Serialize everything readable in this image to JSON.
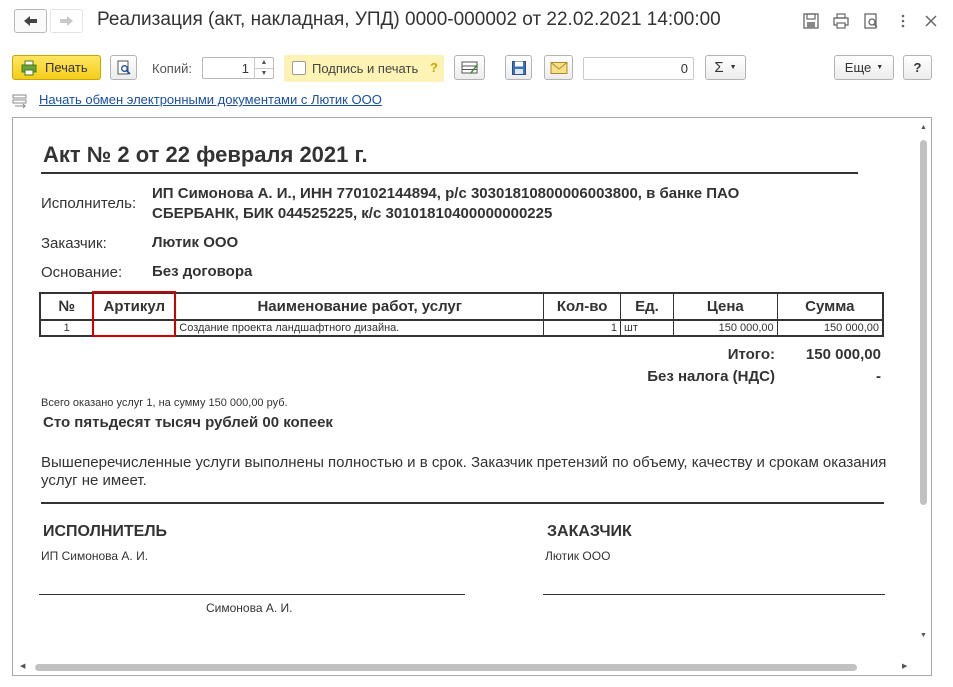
{
  "window": {
    "title": "Реализация (акт, накладная, УПД) 0000-000002 от 22.02.2021 14:00:00"
  },
  "toolbar": {
    "print_label": "Печать",
    "copies_label": "Копий:",
    "copies_value": "1",
    "sign_label": "Подпись и печать",
    "sign_help": "?",
    "sum_value": "0",
    "sigma_label": "Σ",
    "more_label": "Еще",
    "help_label": "?"
  },
  "exchange": {
    "link_text": "Начать обмен электронными документами с Лютик ООО"
  },
  "document": {
    "title": "Акт № 2 от 22 февраля 2021 г.",
    "executor_label": "Исполнитель:",
    "executor_value": "ИП Симонова А. И., ИНН 770102144894, р/с 30301810800006003800, в банке ПАО СБЕРБАНК, БИК 044525225, к/с 30101810400000000225",
    "customer_label": "Заказчик:",
    "customer_value": "Лютик ООО",
    "basis_label": "Основание:",
    "basis_value": "Без договора",
    "table": {
      "headers": [
        "№",
        "Артикул",
        "Наименование работ, услуг",
        "Кол-во",
        "Ед.",
        "Цена",
        "Сумма"
      ],
      "rows": [
        [
          "1",
          "",
          "Создание проекта ландшафтного дизайна.",
          "1",
          "шт",
          "150 000,00",
          "150 000,00"
        ]
      ]
    },
    "total_label": "Итого:",
    "total_value": "150 000,00",
    "vat_label": "Без налога (НДС)",
    "vat_value": "-",
    "summary_small": "Всего оказано услуг 1, на сумму 150 000,00 руб.",
    "summary_words": "Сто пятьдесят тысяч рублей 00 копеек",
    "statement": "Вышеперечисленные услуги выполнены полностью и в срок. Заказчик претензий по объему, качеству и срокам оказания услуг не имеет.",
    "executor_sig_head": "ИСПОЛНИТЕЛЬ",
    "executor_sig_name": "ИП Симонова А. И.",
    "executor_sig_caption": "Симонова А. И.",
    "customer_sig_head": "ЗАКАЗЧИК",
    "customer_sig_name": "Лютик ООО"
  },
  "colors": {
    "print_button": "#f4cd19",
    "sign_box": "#fdf3b4",
    "link": "#1a4fa3",
    "highlight": "#d00000"
  },
  "icons": [
    "back-arrow-icon",
    "forward-arrow-icon",
    "save-icon",
    "print-icon",
    "preview-icon",
    "more-icon",
    "close-icon",
    "print-preview-icon",
    "table-settings-icon",
    "disk-icon",
    "envelope-icon",
    "exchange-icon"
  ]
}
